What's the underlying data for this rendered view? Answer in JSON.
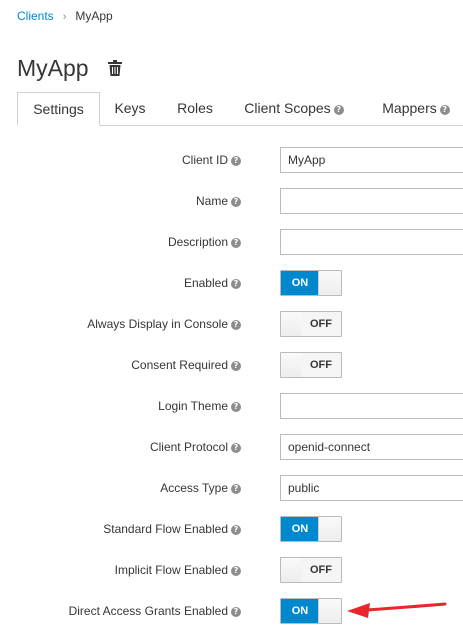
{
  "breadcrumb": {
    "parent": "Clients",
    "separator": "›",
    "current": "MyApp"
  },
  "page": {
    "title": "MyApp",
    "delete_icon": "trash-icon"
  },
  "tabs": [
    {
      "label": "Settings",
      "active": true,
      "help": false
    },
    {
      "label": "Keys",
      "active": false,
      "help": false
    },
    {
      "label": "Roles",
      "active": false,
      "help": false
    },
    {
      "label": "Client Scopes",
      "active": false,
      "help": true
    },
    {
      "label": "Mappers",
      "active": false,
      "help": true
    }
  ],
  "help_icon": "?",
  "toggle_text": {
    "on": "ON",
    "off": "OFF"
  },
  "form": {
    "client_id": {
      "label": "Client ID",
      "value": "MyApp"
    },
    "name": {
      "label": "Name",
      "value": ""
    },
    "description": {
      "label": "Description",
      "value": ""
    },
    "enabled": {
      "label": "Enabled",
      "state": "on"
    },
    "always_display": {
      "label": "Always Display in Console",
      "state": "off"
    },
    "consent_required": {
      "label": "Consent Required",
      "state": "off"
    },
    "login_theme": {
      "label": "Login Theme",
      "value": ""
    },
    "client_protocol": {
      "label": "Client Protocol",
      "value": "openid-connect"
    },
    "access_type": {
      "label": "Access Type",
      "value": "public"
    },
    "standard_flow": {
      "label": "Standard Flow Enabled",
      "state": "on"
    },
    "implicit_flow": {
      "label": "Implicit Flow Enabled",
      "state": "off"
    },
    "direct_access": {
      "label": "Direct Access Grants Enabled",
      "state": "on"
    }
  },
  "colors": {
    "accent": "#0088ce",
    "annotation_arrow": "#e8262b"
  }
}
